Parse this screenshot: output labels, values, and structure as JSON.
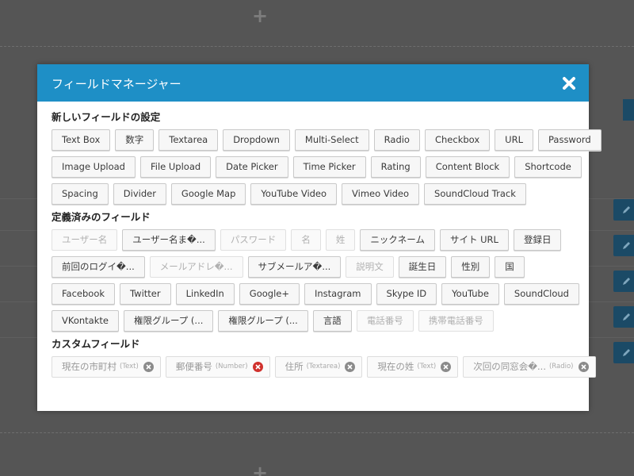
{
  "modal": {
    "title": "フィールドマネージャー",
    "header_color": "#1e8fc6"
  },
  "sections": {
    "new_fields": {
      "title": "新しいフィールドの設定",
      "rows": [
        [
          "Text Box",
          "数字",
          "Textarea",
          "Dropdown",
          "Multi-Select",
          "Radio",
          "Checkbox",
          "URL",
          "Password"
        ],
        [
          "Image Upload",
          "File Upload",
          "Date Picker",
          "Time Picker",
          "Rating",
          "Content Block",
          "Shortcode"
        ],
        [
          "Spacing",
          "Divider",
          "Google Map",
          "YouTube Video",
          "Vimeo Video",
          "SoundCloud Track"
        ]
      ]
    },
    "predefined": {
      "title": "定義済みのフィールド",
      "rows": [
        [
          {
            "label": "ユーザー名",
            "disabled": true
          },
          {
            "label": "ユーザー名ま�...",
            "disabled": false
          },
          {
            "label": "パスワード",
            "disabled": true
          },
          {
            "label": "名",
            "disabled": true
          },
          {
            "label": "姓",
            "disabled": true
          },
          {
            "label": "ニックネーム",
            "disabled": false
          },
          {
            "label": "サイト URL",
            "disabled": false
          },
          {
            "label": "登録日",
            "disabled": false
          }
        ],
        [
          {
            "label": "前回のログイ�...",
            "disabled": false
          },
          {
            "label": "メールアドレ�...",
            "disabled": true
          },
          {
            "label": "サブメールア�...",
            "disabled": false
          },
          {
            "label": "説明文",
            "disabled": true
          },
          {
            "label": "誕生日",
            "disabled": false
          },
          {
            "label": "性別",
            "disabled": false
          },
          {
            "label": "国",
            "disabled": false
          }
        ],
        [
          {
            "label": "Facebook",
            "disabled": false
          },
          {
            "label": "Twitter",
            "disabled": false
          },
          {
            "label": "LinkedIn",
            "disabled": false
          },
          {
            "label": "Google+",
            "disabled": false
          },
          {
            "label": "Instagram",
            "disabled": false
          },
          {
            "label": "Skype ID",
            "disabled": false
          },
          {
            "label": "YouTube",
            "disabled": false
          },
          {
            "label": "SoundCloud",
            "disabled": false
          }
        ],
        [
          {
            "label": "VKontakte",
            "disabled": false
          },
          {
            "label": "権限グループ (...",
            "disabled": false
          },
          {
            "label": "権限グループ (...",
            "disabled": false
          },
          {
            "label": "言語",
            "disabled": false
          },
          {
            "label": "電話番号",
            "disabled": true
          },
          {
            "label": "携帯電話番号",
            "disabled": true
          }
        ]
      ]
    },
    "custom": {
      "title": "カスタムフィールド",
      "items": [
        {
          "label": "現在の市町村",
          "type": "(Text)",
          "remove_icon_color": "#8b8b8b"
        },
        {
          "label": "郵便番号",
          "type": "(Number)",
          "remove_icon_color": "#d0312d"
        },
        {
          "label": "住所",
          "type": "(Textarea)",
          "remove_icon_color": "#8b8b8b"
        },
        {
          "label": "現在の姓",
          "type": "(Text)",
          "remove_icon_color": "#8b8b8b"
        },
        {
          "label": "次回の同窓会�...",
          "type": "(Radio)",
          "remove_icon_color": "#8b8b8b"
        }
      ]
    }
  },
  "icons": {
    "close": "close-icon",
    "remove": "remove-icon",
    "add": "plus-icon",
    "edit": "pencil-icon"
  }
}
